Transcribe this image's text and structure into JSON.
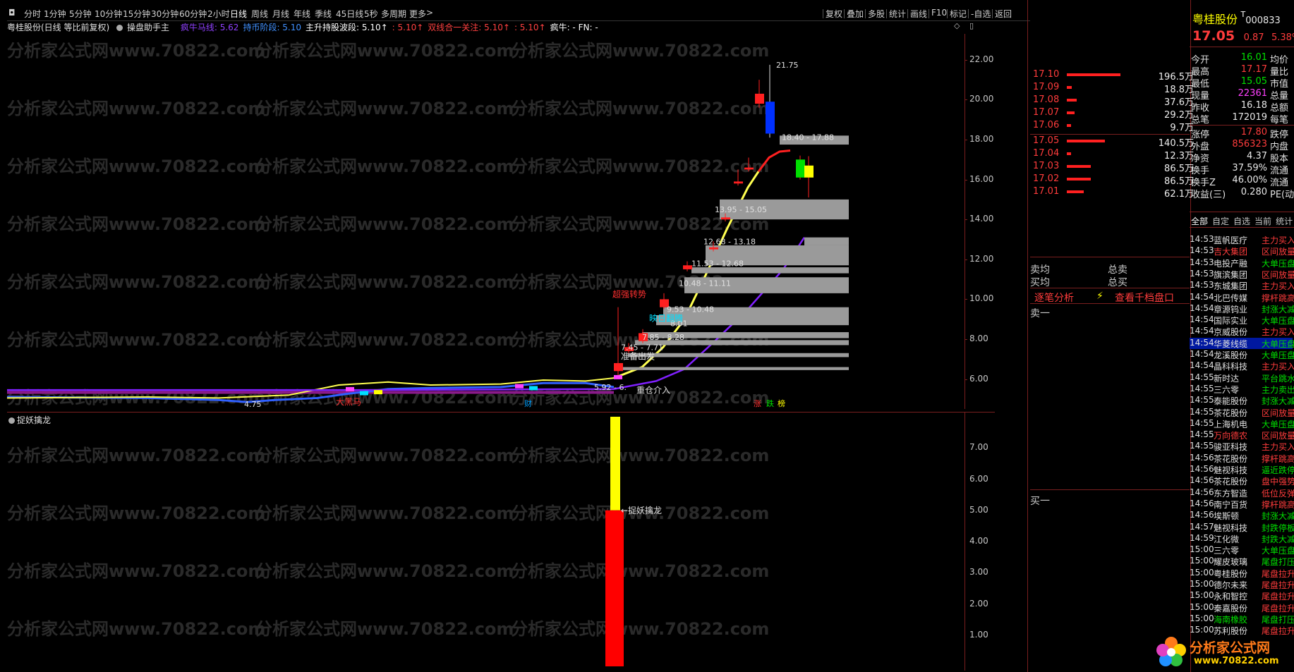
{
  "toolbar": {
    "periods": [
      "分时",
      "1分钟",
      "5分钟",
      "10分钟",
      "15分钟",
      "30分钟",
      "60分钟",
      "2小时",
      "日线",
      "周线",
      "月线",
      "年线",
      "季线",
      "45日线",
      "5秒",
      "多周期",
      "更多"
    ],
    "active": "日线",
    "right_tools": [
      "复权",
      "叠加",
      "多股",
      "统计",
      "画线",
      "F10",
      "标记",
      "-自选",
      "返回"
    ]
  },
  "indicator_line": {
    "stock_label": "粤桂股份(日线 等比前复权)",
    "formula": "操盘助手主",
    "segments": [
      {
        "text": "疯牛马线: 5.62",
        "color": "#9040ff"
      },
      {
        "text": "持币阶段: 5.10",
        "color": "#4090ff"
      },
      {
        "text": "主升持股波段: 5.10↑",
        "color": "#ffffff"
      },
      {
        "text": ": 5.10↑",
        "color": "#ff4040"
      },
      {
        "text": "双线合一关注: 5.10↑",
        "color": "#ff4040"
      },
      {
        "text": ": 5.10↑",
        "color": "#ff4040"
      },
      {
        "text": "疯牛: -  FN: -",
        "color": "#ffffff"
      }
    ]
  },
  "main_chart": {
    "y_ticks": [
      "22.00",
      "20.00",
      "18.00",
      "16.00",
      "14.00",
      "12.00",
      "10.00",
      "8.00",
      "6.00"
    ],
    "y_range": [
      4.5,
      23.3
    ],
    "annotations": {
      "high_label": "21.75",
      "low_label": "4.75",
      "range_18": "18.40 - 17.88",
      "range_13": "13.95 - 15.05",
      "range_12": "12.68 - 13.18",
      "range_11": "11.53 - 12.68",
      "range_10": "10.48 - 11.11",
      "range_9": "9.53 - 10.48",
      "range_8": "8.01",
      "range_7": "7.85 - 8.28",
      "range_7b": "7.45 - 7.71",
      "range_5": "5.92 - 6.",
      "sig_strong": "超强转势",
      "sig_main": "映日翻腾",
      "sig_prep": "准备出发",
      "sig_heavy": "重仓介入",
      "sig_horse": "大黑马",
      "sig_cai": "财",
      "sig_zhang": "涨",
      "sig_die": "跌",
      "sig_bang": "榜"
    }
  },
  "sub_chart": {
    "title": "捉妖擒龙",
    "y_ticks": [
      "7.00",
      "6.00",
      "5.00",
      "4.00",
      "3.00",
      "2.00",
      "1.00"
    ],
    "y_range": [
      0,
      8
    ],
    "bar_yellow_top": 8.0,
    "bar_red_top": 5.0,
    "label": "←捉妖擒龙"
  },
  "watermark": "分析家公式网www.70822.com",
  "quote": {
    "name": "粤桂股份",
    "code": "000833",
    "price": "17.05",
    "change": "0.87",
    "change_pct": "5.38%",
    "asks": [
      {
        "price": "17.10",
        "vol": "196.5万",
        "ratio": 0.95
      },
      {
        "price": "17.09",
        "vol": "18.8万",
        "ratio": 0.09
      },
      {
        "price": "17.08",
        "vol": "37.6万",
        "ratio": 0.18
      },
      {
        "price": "17.07",
        "vol": "29.2万",
        "ratio": 0.14
      },
      {
        "price": "17.06",
        "vol": "9.7万",
        "ratio": 0.05
      }
    ],
    "bids": [
      {
        "price": "17.05",
        "vol": "140.5万",
        "ratio": 0.68
      },
      {
        "price": "17.04",
        "vol": "12.3万",
        "ratio": 0.06
      },
      {
        "price": "17.03",
        "vol": "86.5万",
        "ratio": 0.42
      },
      {
        "price": "17.02",
        "vol": "86.5万",
        "ratio": 0.42
      },
      {
        "price": "17.01",
        "vol": "62.1万",
        "ratio": 0.3
      }
    ],
    "stats": [
      {
        "label": "今开",
        "value": "16.01",
        "vcolor": "#00e000",
        "extra": "均价"
      },
      {
        "label": "最高",
        "value": "17.17",
        "vcolor": "#ff3c3c",
        "extra": "量比"
      },
      {
        "label": "最低",
        "value": "15.05",
        "vcolor": "#00e000",
        "extra": "市值"
      },
      {
        "label": "现量",
        "value": "22361",
        "vcolor": "#ff40ff",
        "extra": "总量"
      },
      {
        "label": "昨收",
        "value": "16.18",
        "vcolor": "#e8e8e8",
        "extra": "总额"
      },
      {
        "label": "总笔",
        "value": "172019",
        "vcolor": "#e8e8e8",
        "extra": "每笔"
      },
      {
        "label": "涨停",
        "value": "17.80",
        "vcolor": "#ff3c3c",
        "extra": "跌停"
      },
      {
        "label": "外盘",
        "value": "856323",
        "vcolor": "#ff3c3c",
        "extra": "内盘"
      },
      {
        "label": "净资",
        "value": "4.37",
        "vcolor": "#e8e8e8",
        "extra": "股本"
      },
      {
        "label": "换手",
        "value": "37.59%",
        "vcolor": "#e8e8e8",
        "extra": "流通"
      },
      {
        "label": "换手Z",
        "value": "46.00%",
        "vcolor": "#e8e8e8",
        "extra": "流通"
      },
      {
        "label": "收益(三)",
        "value": "0.280",
        "vcolor": "#e8e8e8",
        "extra": "PE(动"
      }
    ],
    "mid": {
      "sell_avg": "卖均",
      "sell_total": "总卖",
      "buy_avg": "买均",
      "buy_total": "总买",
      "tick_analysis": "逐笔分析",
      "thousand": "查看千档盘口",
      "ask1": "卖一",
      "bid1": "买一"
    },
    "list_tabs": [
      "全部",
      "自定",
      "自选",
      "当前",
      "统计"
    ],
    "ticker": [
      {
        "t": "14:53",
        "n": "蓝帆医疗",
        "s": "主力买入",
        "nc": "#e0e0e0",
        "sc": "#ff3c3c"
      },
      {
        "t": "14:53",
        "n": "吉大集团",
        "s": "区间放量",
        "nc": "#ff3c3c",
        "sc": "#ff3c3c"
      },
      {
        "t": "14:53",
        "n": "电投产融",
        "s": "大单压盘",
        "nc": "#e0e0e0",
        "sc": "#00e000"
      },
      {
        "t": "14:53",
        "n": "旗滨集团",
        "s": "区间放量",
        "nc": "#e0e0e0",
        "sc": "#ff3c3c"
      },
      {
        "t": "14:53",
        "n": "东城集团",
        "s": "主力买入",
        "nc": "#e0e0e0",
        "sc": "#ff3c3c"
      },
      {
        "t": "14:54",
        "n": "北巴传媒",
        "s": "撑杆跳高",
        "nc": "#e0e0e0",
        "sc": "#ff3c3c"
      },
      {
        "t": "14:54",
        "n": "章源钨业",
        "s": "封涨大减",
        "nc": "#e0e0e0",
        "sc": "#00e000"
      },
      {
        "t": "14:54",
        "n": "国际实业",
        "s": "大单压盘",
        "nc": "#e0e0e0",
        "sc": "#00e000"
      },
      {
        "t": "14:54",
        "n": "京威股份",
        "s": "主力买入",
        "nc": "#e0e0e0",
        "sc": "#ff3c3c"
      },
      {
        "t": "14:54",
        "n": "华菱线缆",
        "s": "大单压盘",
        "nc": "#e0e0e0",
        "sc": "#00e000",
        "hl": true
      },
      {
        "t": "14:54",
        "n": "龙溪股份",
        "s": "大单压盘",
        "nc": "#e0e0e0",
        "sc": "#00e000"
      },
      {
        "t": "14:54",
        "n": "晶科科技",
        "s": "主力买入",
        "nc": "#e0e0e0",
        "sc": "#ff3c3c"
      },
      {
        "t": "14:55",
        "n": "新时达",
        "s": "平台跳水",
        "nc": "#e0e0e0",
        "sc": "#00e000"
      },
      {
        "t": "14:55",
        "n": "三六零",
        "s": "主力卖出",
        "nc": "#e0e0e0",
        "sc": "#00e000"
      },
      {
        "t": "14:55",
        "n": "泰能股份",
        "s": "封涨大减",
        "nc": "#e0e0e0",
        "sc": "#00e000"
      },
      {
        "t": "14:55",
        "n": "茶花股份",
        "s": "区间放量",
        "nc": "#e0e0e0",
        "sc": "#ff3c3c"
      },
      {
        "t": "14:55",
        "n": "上海机电",
        "s": "大单压盘",
        "nc": "#e0e0e0",
        "sc": "#00e000"
      },
      {
        "t": "14:55",
        "n": "万向德农",
        "s": "区间放量",
        "nc": "#ff3c3c",
        "sc": "#ff3c3c"
      },
      {
        "t": "14:55",
        "n": "骏亚科技",
        "s": "主力买入",
        "nc": "#e0e0e0",
        "sc": "#ff3c3c"
      },
      {
        "t": "14:56",
        "n": "茶花股份",
        "s": "撑杆跳高",
        "nc": "#e0e0e0",
        "sc": "#ff3c3c"
      },
      {
        "t": "14:56",
        "n": "魅视科技",
        "s": "逼近跌停",
        "nc": "#e0e0e0",
        "sc": "#00e000"
      },
      {
        "t": "14:56",
        "n": "茶花股份",
        "s": "盘中强势",
        "nc": "#e0e0e0",
        "sc": "#ff3c3c"
      },
      {
        "t": "14:56",
        "n": "东方智造",
        "s": "低位反弹",
        "nc": "#e0e0e0",
        "sc": "#ff3c3c"
      },
      {
        "t": "14:56",
        "n": "南宁百货",
        "s": "撑杆跳高",
        "nc": "#e0e0e0",
        "sc": "#ff3c3c"
      },
      {
        "t": "14:56",
        "n": "埃斯顿",
        "s": "封涨大减",
        "nc": "#e0e0e0",
        "sc": "#00e000"
      },
      {
        "t": "14:57",
        "n": "魅视科技",
        "s": "封跌停板",
        "nc": "#e0e0e0",
        "sc": "#00e000"
      },
      {
        "t": "14:59",
        "n": "江化微",
        "s": "封跌大减",
        "nc": "#e0e0e0",
        "sc": "#00e000"
      },
      {
        "t": "15:00",
        "n": "三六零",
        "s": "大单压盘",
        "nc": "#e0e0e0",
        "sc": "#00e000"
      },
      {
        "t": "15:00",
        "n": "耀皮玻璃",
        "s": "尾盘打压",
        "nc": "#e0e0e0",
        "sc": "#00e000"
      },
      {
        "t": "15:00",
        "n": "粤桂股份",
        "s": "尾盘拉升",
        "nc": "#e0e0e0",
        "sc": "#ff3c3c"
      },
      {
        "t": "15:00",
        "n": "德尔未来",
        "s": "尾盘拉升",
        "nc": "#e0e0e0",
        "sc": "#ff3c3c"
      },
      {
        "t": "15:00",
        "n": "永和智控",
        "s": "尾盘拉升",
        "nc": "#e0e0e0",
        "sc": "#ff3c3c"
      },
      {
        "t": "15:00",
        "n": "秦嘉股份",
        "s": "尾盘拉升",
        "nc": "#e0e0e0",
        "sc": "#ff3c3c"
      },
      {
        "t": "15:00",
        "n": "海南橡胶",
        "s": "尾盘打压",
        "nc": "#00e000",
        "sc": "#00e000"
      },
      {
        "t": "15:00",
        "n": "苏利股份",
        "s": "尾盘拉升",
        "nc": "#e0e0e0",
        "sc": "#ff3c3c"
      }
    ],
    "logo_text": "分析家公式网",
    "logo_url": "www.70822.com"
  }
}
